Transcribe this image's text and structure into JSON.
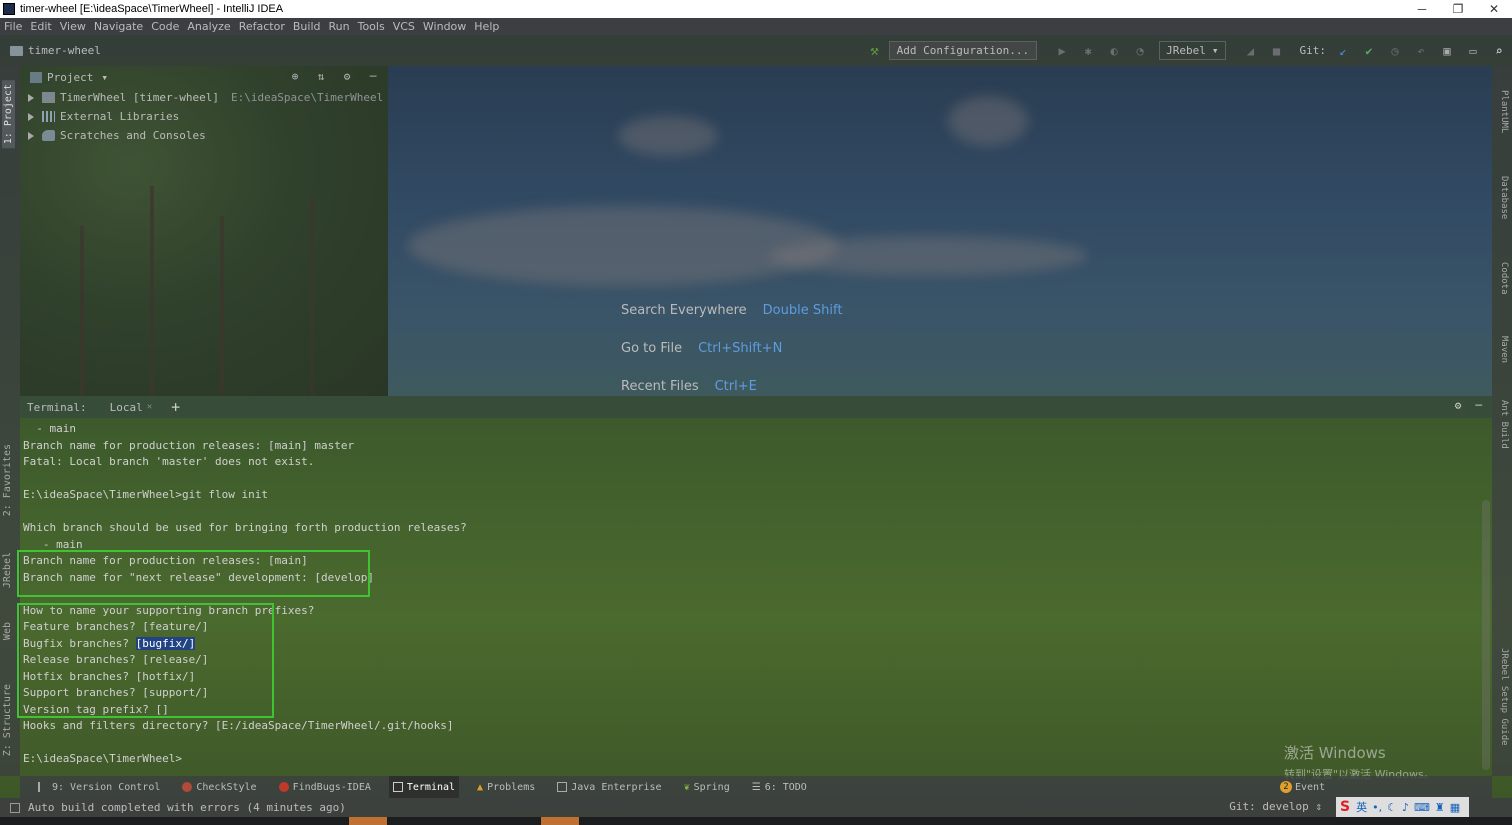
{
  "window": {
    "title": "timer-wheel [E:\\ideaSpace\\TimerWheel] - IntelliJ IDEA",
    "controls": [
      "─",
      "❐",
      "✕"
    ]
  },
  "menu": [
    "File",
    "Edit",
    "View",
    "Navigate",
    "Code",
    "Analyze",
    "Refactor",
    "Build",
    "Run",
    "Tools",
    "VCS",
    "Window",
    "Help"
  ],
  "toolbar": {
    "breadcrumb": "timer-wheel",
    "add_configuration": "Add Configuration...",
    "jrebel": "JRebel",
    "git_label": "Git:"
  },
  "left_stripe": {
    "project": "1: Project",
    "favorites": "2: Favorites",
    "jrebel": "JRebel",
    "web": "Web",
    "structure": "Z: Structure"
  },
  "right_stripe": {
    "plantuml": "PlantUML",
    "database": "Database",
    "codota": "Codota",
    "maven": "Maven",
    "ant": "Ant Build",
    "jrebel_guide": "JRebel Setup Guide"
  },
  "project_panel": {
    "title": "Project",
    "items": [
      {
        "name": "TimerWheel [timer-wheel]",
        "path": "E:\\ideaSpace\\TimerWheel"
      },
      {
        "name": "External Libraries",
        "path": ""
      },
      {
        "name": "Scratches and Consoles",
        "path": ""
      }
    ]
  },
  "welcome": {
    "search_label": "Search Everywhere",
    "search_key": "Double Shift",
    "goto_label": "Go to File",
    "goto_key": "Ctrl+Shift+N",
    "recent_label": "Recent Files",
    "recent_key": "Ctrl+E"
  },
  "terminal": {
    "label": "Terminal:",
    "tab": "Local",
    "lines": [
      "  - main",
      "Branch name for production releases: [main] master",
      "Fatal: Local branch 'master' does not exist.",
      "",
      "E:\\ideaSpace\\TimerWheel>git flow init",
      "",
      "Which branch should be used for bringing forth production releases?",
      "   - main",
      "Branch name for production releases: [main]",
      "Branch name for \"next release\" development: [develop]",
      "",
      "How to name your supporting branch prefixes?",
      "Feature branches? [feature/]",
      "Bugfix branches? ",
      "Release branches? [release/]",
      "Hotfix branches? [hotfix/]",
      "Support branches? [support/]",
      "Version tag prefix? []",
      "Hooks and filters directory? [E:/ideaSpace/TimerWheel/.git/hooks]",
      "",
      "E:\\ideaSpace\\TimerWheel>"
    ],
    "bugfix_highlight": "[bugfix/]"
  },
  "bottom_tools": [
    {
      "label": "9: Version Control"
    },
    {
      "label": "CheckStyle"
    },
    {
      "label": "FindBugs-IDEA"
    },
    {
      "label": "Terminal"
    },
    {
      "label": "Problems"
    },
    {
      "label": "Java Enterprise"
    },
    {
      "label": "Spring"
    },
    {
      "label": "6: TODO"
    }
  ],
  "status": {
    "message": "Auto build completed with errors (4 minutes ago)",
    "git_branch": "Git: develop ⇕",
    "event_count": "2",
    "event_label": "Event"
  },
  "watermark": {
    "line1": "激活 Windows",
    "line2": "转到\"设置\"以激活 Windows。"
  },
  "tray": {
    "ime": "英"
  },
  "colors": {
    "highlight_box": "#3fc234",
    "shortcut_blue": "#5d9de0",
    "selection": "#214283"
  }
}
